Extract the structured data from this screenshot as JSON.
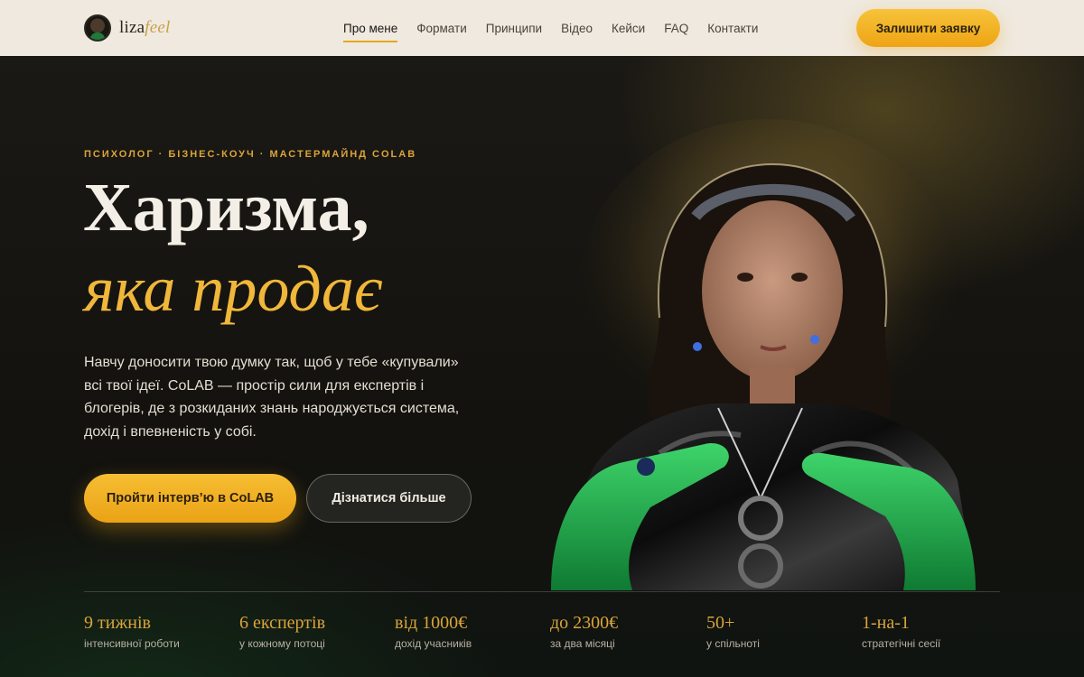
{
  "brand": {
    "name_main": "liza",
    "name_accent": "feel"
  },
  "nav": {
    "links": [
      "Про мене",
      "Формати",
      "Принципи",
      "Відео",
      "Кейси",
      "FAQ",
      "Контакти"
    ],
    "active_index": 0,
    "cta_label": "Залишити заявку"
  },
  "hero": {
    "eyebrow": "ПСИХОЛОГ · БІЗНЕС-КОУЧ · МАСТЕРМАЙНД COLAB",
    "headline_line1": "Харизма,",
    "headline_line2": "яка продає",
    "lead": "Навчу доносити твою думку так, щоб у тебе «купували» всі твої ідеї. CoLAB — простір сили для експертів і блогерів, де з розкиданих знань народжується система, дохід і впевненість у собі.",
    "primary_button": "Пройти інтерв’ю в CoLAB",
    "secondary_button": "Дізнатися більше"
  },
  "stats": [
    {
      "value": "9 тижнів",
      "label": "інтенсивної роботи"
    },
    {
      "value": "6 експертів",
      "label": "у кожному потоці"
    },
    {
      "value": "від 1000€",
      "label": "дохід учасників"
    },
    {
      "value": "до 2300€",
      "label": "за два місяці"
    },
    {
      "value": "50+",
      "label": "у спільноті"
    },
    {
      "value": "1-на-1",
      "label": "стратегічні сесії"
    }
  ],
  "colors": {
    "accent": "#eea414",
    "accent_text": "#d9a43a",
    "nav_bg": "#efe9df",
    "hero_bg": "#15130f",
    "glove_green": "#1fa84a"
  },
  "icons": {
    "brand_avatar": "avatar-photo"
  }
}
